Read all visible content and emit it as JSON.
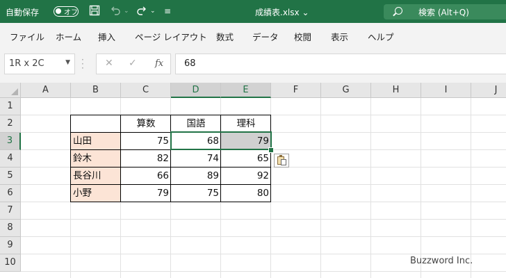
{
  "titlebar": {
    "autosave_label": "自動保存",
    "autosave_state": "オフ",
    "filename": "成績表.xlsx",
    "search_placeholder": "検索 (Alt+Q)"
  },
  "menu": [
    "ファイル",
    "ホーム",
    "挿入",
    "ページ レイアウト",
    "数式",
    "データ",
    "校閲",
    "表示",
    "ヘルプ"
  ],
  "formula_bar": {
    "name_box": "1R x 2C",
    "formula": "68"
  },
  "columns": [
    "A",
    "B",
    "C",
    "D",
    "E",
    "F",
    "G",
    "H",
    "I",
    "J"
  ],
  "rows": [
    "1",
    "2",
    "3",
    "4",
    "5",
    "6",
    "7",
    "8",
    "9",
    "10"
  ],
  "table": {
    "headers": [
      "算数",
      "国語",
      "理科"
    ],
    "data": [
      {
        "name": "山田",
        "values": [
          "75",
          "68",
          "79"
        ]
      },
      {
        "name": "鈴木",
        "values": [
          "82",
          "74",
          "65"
        ]
      },
      {
        "name": "長谷川",
        "values": [
          "66",
          "89",
          "92"
        ]
      },
      {
        "name": "小野",
        "values": [
          "79",
          "75",
          "80"
        ]
      }
    ]
  },
  "selection": "D3:E3",
  "watermark": "Buzzword Inc.",
  "colors": {
    "accent": "#217346",
    "name_fill": "#fce4d6",
    "filled_cell": "#d0d0d0"
  }
}
